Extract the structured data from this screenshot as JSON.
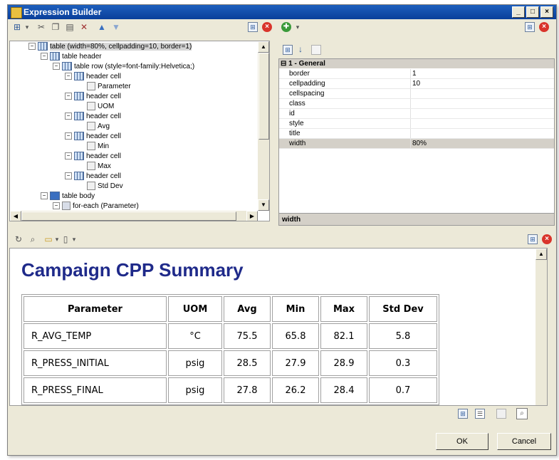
{
  "window": {
    "title": "Expression Builder"
  },
  "tree": {
    "rows": [
      {
        "label": "table (width=80%, cellpadding=10, border=1)",
        "exp": "−"
      },
      {
        "label": "table header",
        "exp": "−"
      },
      {
        "label": "table row (style=font-family:Helvetica;)",
        "exp": "−"
      },
      {
        "label": "header cell",
        "exp": "−"
      },
      {
        "label": "Parameter",
        "exp": ""
      },
      {
        "label": "header cell",
        "exp": "−"
      },
      {
        "label": "UOM",
        "exp": ""
      },
      {
        "label": "header cell",
        "exp": "−"
      },
      {
        "label": "Avg",
        "exp": ""
      },
      {
        "label": "header cell",
        "exp": "−"
      },
      {
        "label": "Min",
        "exp": ""
      },
      {
        "label": "header cell",
        "exp": "−"
      },
      {
        "label": "Max",
        "exp": ""
      },
      {
        "label": "header cell",
        "exp": "−"
      },
      {
        "label": "Std Dev",
        "exp": ""
      },
      {
        "label": "table body",
        "exp": "−"
      },
      {
        "label": "for-each (Parameter)",
        "exp": "−"
      }
    ]
  },
  "properties": {
    "category": "1 - General",
    "category_toggle": "⊟",
    "rows": [
      {
        "name": "border",
        "value": "1"
      },
      {
        "name": "cellpadding",
        "value": "10"
      },
      {
        "name": "cellspacing",
        "value": ""
      },
      {
        "name": "class",
        "value": ""
      },
      {
        "name": "id",
        "value": ""
      },
      {
        "name": "style",
        "value": ""
      },
      {
        "name": "title",
        "value": ""
      },
      {
        "name": "width",
        "value": "80%"
      }
    ],
    "description": "width"
  },
  "preview": {
    "title": "Campaign CPP Summary",
    "headers": [
      "Parameter",
      "UOM",
      "Avg",
      "Min",
      "Max",
      "Std Dev"
    ],
    "rows": [
      [
        "R_AVG_TEMP",
        "°C",
        "75.5",
        "65.8",
        "82.1",
        "5.8"
      ],
      [
        "R_PRESS_INITIAL",
        "psig",
        "28.5",
        "27.9",
        "28.9",
        "0.3"
      ],
      [
        "R_PRESS_FINAL",
        "psig",
        "27.8",
        "26.2",
        "28.4",
        "0.7"
      ]
    ]
  },
  "buttons": {
    "ok": "OK",
    "cancel": "Cancel"
  },
  "icons": {
    "minimize": "_",
    "maximize": "□",
    "close": "×",
    "dropdown": "▾",
    "cut": "✂",
    "copy": "❐",
    "paste": "▤",
    "delete": "✕",
    "up": "▲",
    "down": "▼",
    "add": "✚",
    "expand": "⊞",
    "close_x": "×",
    "sort_alpha": "↓",
    "scroll_left": "◀",
    "scroll_right": "▶",
    "scroll_up": "▲",
    "scroll_down": "▼"
  },
  "colors": {
    "title_bar": "#0a3f9a",
    "heading": "#1f2a8a",
    "close_red": "#d9342b"
  }
}
